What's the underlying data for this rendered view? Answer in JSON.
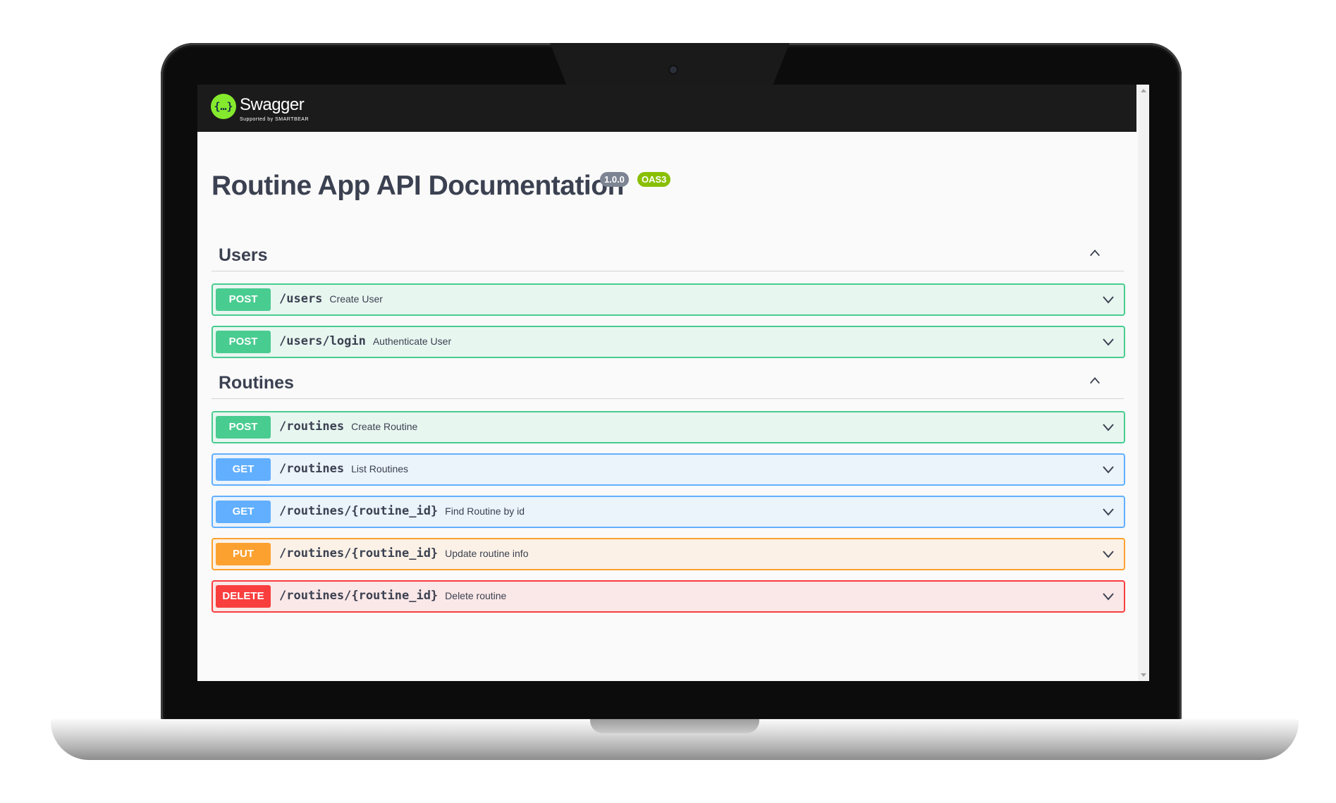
{
  "header": {
    "brand": "Swagger",
    "brand_sub": "Supported by SMARTBEAR",
    "logo_glyph": "{…}"
  },
  "info": {
    "title": "Routine App API Documentation",
    "version": "1.0.0",
    "oas": "OAS3"
  },
  "tags": [
    {
      "name": "Users",
      "operations": [
        {
          "method": "POST",
          "path": "/users",
          "summary": "Create User"
        },
        {
          "method": "POST",
          "path": "/users/login",
          "summary": "Authenticate User"
        }
      ]
    },
    {
      "name": "Routines",
      "operations": [
        {
          "method": "POST",
          "path": "/routines",
          "summary": "Create Routine"
        },
        {
          "method": "GET",
          "path": "/routines",
          "summary": "List Routines"
        },
        {
          "method": "GET",
          "path": "/routines/{routine_id}",
          "summary": "Find Routine by id"
        },
        {
          "method": "PUT",
          "path": "/routines/{routine_id}",
          "summary": "Update routine info"
        },
        {
          "method": "DELETE",
          "path": "/routines/{routine_id}",
          "summary": "Delete routine"
        }
      ]
    }
  ],
  "colors": {
    "post": "#49cc90",
    "get": "#61affe",
    "put": "#fca130",
    "delete": "#f93e3e",
    "swagger_green": "#85ea2d"
  }
}
